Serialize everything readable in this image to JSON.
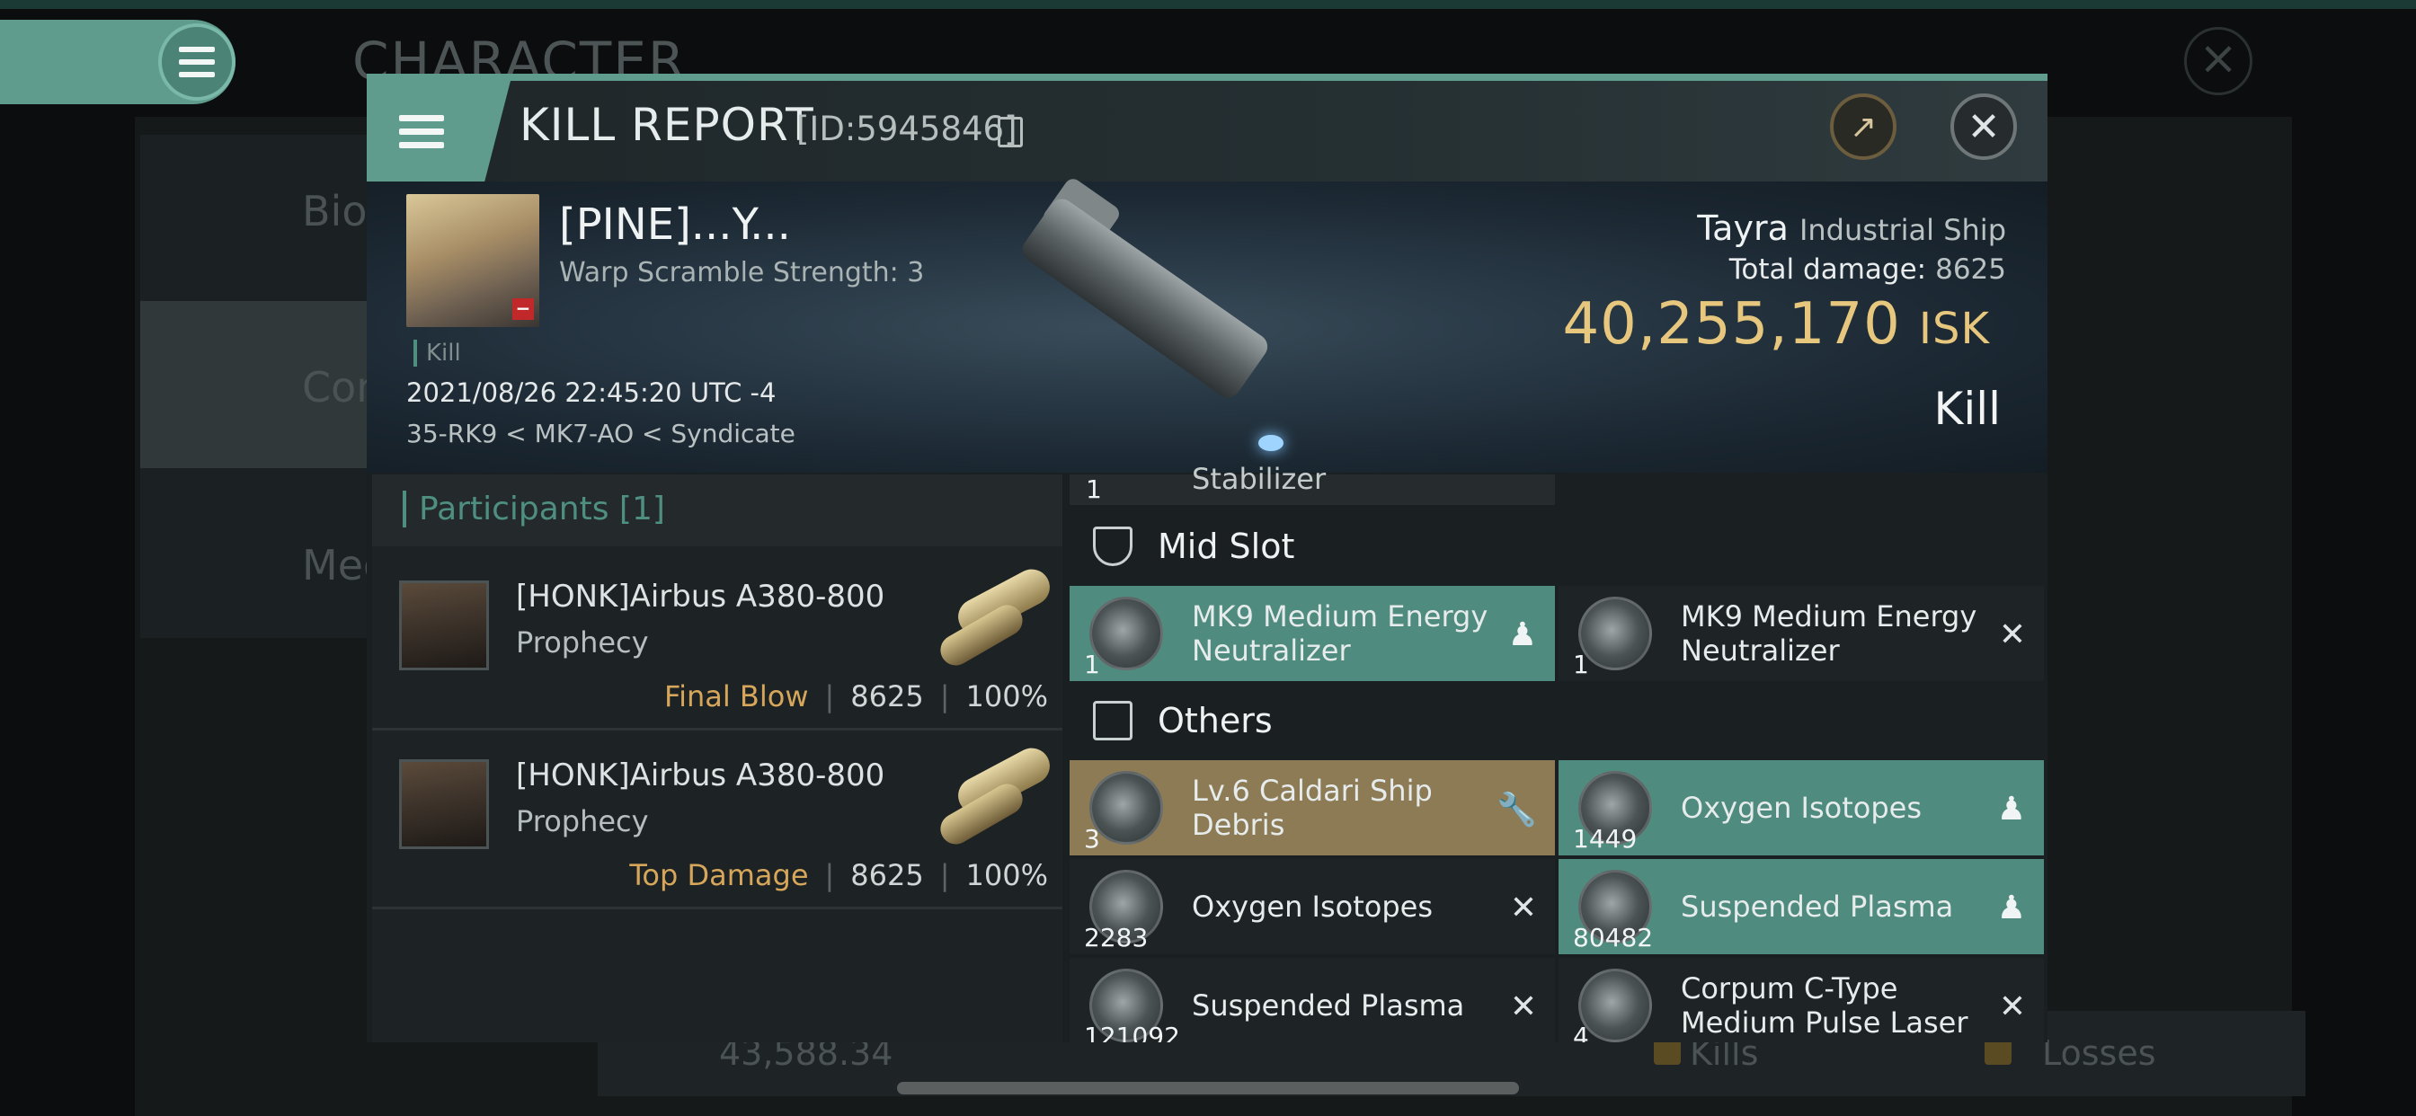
{
  "background": {
    "title": "CHARACTER",
    "side_items": [
      "Bio",
      "Con",
      "Med"
    ],
    "bottom_value": "43,588.34",
    "bottom_kills": "Kills",
    "bottom_losses": "Losses"
  },
  "header": {
    "title": "KILL REPORT",
    "id_text": "[ID:5945846]"
  },
  "victim": {
    "name": "[PINE]...Y...",
    "warp": "Warp Scramble Strength: 3",
    "kill_tag": "Kill",
    "datetime": "2021/08/26 22:45:20 UTC -4",
    "location": "35-RK9 < MK7-AO < Syndicate",
    "ship_name": "Tayra",
    "ship_class": "Industrial Ship",
    "total_damage_label": "Total damage:",
    "total_damage": "8625",
    "isk_value": "40,255,170",
    "isk_unit": "ISK",
    "result": "Kill"
  },
  "participants": {
    "title": "Participants [1]",
    "rows": [
      {
        "name": "[HONK]Airbus A380-800",
        "ship": "Prophecy",
        "role": "Final Blow",
        "damage": "8625",
        "percent": "100%"
      },
      {
        "name": "[HONK]Airbus A380-800",
        "ship": "Prophecy",
        "role": "Top Damage",
        "damage": "8625",
        "percent": "100%"
      }
    ]
  },
  "items": {
    "partial_row": {
      "qty": "1",
      "name": "Stabilizer"
    },
    "mid_slot_label": "Mid Slot",
    "others_label": "Others",
    "mid_slot": [
      {
        "qty": "1",
        "name": "MK9 Medium Energy Neutralizer",
        "status": "person-icon",
        "style": "teal"
      },
      {
        "qty": "1",
        "name": "MK9 Medium Energy Neutralizer",
        "status": "destroyed-icon",
        "style": "dark"
      }
    ],
    "others": [
      {
        "qty": "3",
        "name": "Lv.6 Caldari Ship Debris",
        "status": "wrench-icon",
        "style": "gold"
      },
      {
        "qty": "1449",
        "name": "Oxygen Isotopes",
        "status": "person-icon",
        "style": "teal"
      },
      {
        "qty": "2283",
        "name": "Oxygen Isotopes",
        "status": "destroyed-icon",
        "style": "dark"
      },
      {
        "qty": "80482",
        "name": "Suspended Plasma",
        "status": "person-icon",
        "style": "teal"
      },
      {
        "qty": "121092",
        "name": "Suspended Plasma",
        "status": "destroyed-icon",
        "style": "dark"
      },
      {
        "qty": "4",
        "name": "Corpum C-Type Medium Pulse Laser",
        "status": "destroyed-icon",
        "style": "dark"
      }
    ]
  },
  "icons": {
    "menu": "menu-icon",
    "share": "share-icon",
    "close": "close-icon",
    "copy": "copy-icon"
  },
  "colors": {
    "accent_teal": "#5f9c8d",
    "isk_gold": "#e6c77d",
    "role_gold": "#d6a75a",
    "dropped_gold": "#8d7b56"
  }
}
